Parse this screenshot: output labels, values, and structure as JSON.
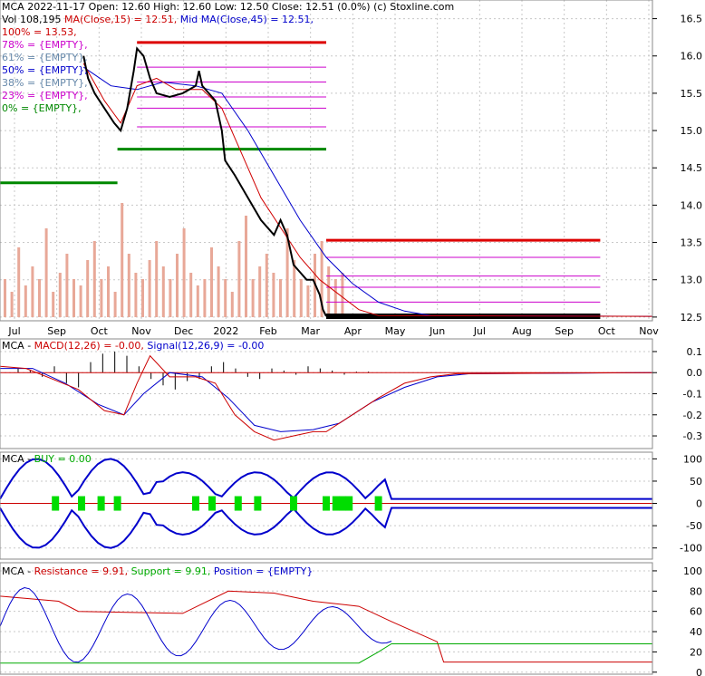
{
  "colors": {
    "price": "#000000",
    "ma_fast": "#d00000",
    "ma_slow": "#0000cc",
    "volume": "#e8a898",
    "support": "#008800",
    "resistance": "#dd0000",
    "fib": "#cc00cc",
    "buy": "#00dd00",
    "position": "#0000cc",
    "grid": "#c8c8c8"
  },
  "header": {
    "title_line": "MCA  2022-11-17 Open: 12.60  High: 12.60  Low: 12.50  Close: 12.51 (0.0%)  (c) Stoxline.com",
    "vol_prefix": "Vol 108,195 ",
    "ma15_label": "MA(Close,15) = 12.51,",
    "ma45_label": " Mid MA(Close,45) = 12.51,",
    "fib_levels": [
      {
        "label": "100% = 13.53,",
        "color": "#cc0000"
      },
      {
        "label": "78% = {EMPTY},",
        "color": "#cc00cc"
      },
      {
        "label": "61% = {EMPTY},",
        "color": "#6688aa"
      },
      {
        "label": "50% = {EMPTY},",
        "color": "#0000cc"
      },
      {
        "label": "38% = {EMPTY},",
        "color": "#6688aa"
      },
      {
        "label": "23% = {EMPTY},",
        "color": "#cc00cc"
      },
      {
        "label": "0% = {EMPTY},",
        "color": "#008800"
      }
    ]
  },
  "chart_data": [
    {
      "type": "line",
      "panel": "price",
      "title": "MCA  2022-11-17 Open: 12.60  High: 12.60  Low: 12.50  Close: 12.51 (0.0%)  (c) Stoxline.com",
      "x_labels": [
        "Jul",
        "Sep",
        "Oct",
        "Nov",
        "Dec",
        "2022",
        "Feb",
        "Mar",
        "Apr",
        "May",
        "Jun",
        "Jul",
        "Aug",
        "Sep",
        "Oct",
        "Nov"
      ],
      "y_ticks": [
        12.5,
        13.0,
        13.5,
        14.0,
        14.5,
        15.0,
        15.5,
        16.0,
        16.5
      ],
      "ylim": [
        12.45,
        16.75
      ],
      "price_points": [
        [
          0.128,
          16.0
        ],
        [
          0.135,
          15.7
        ],
        [
          0.145,
          15.5
        ],
        [
          0.16,
          15.3
        ],
        [
          0.175,
          15.1
        ],
        [
          0.185,
          15.0
        ],
        [
          0.195,
          15.3
        ],
        [
          0.205,
          15.8
        ],
        [
          0.21,
          16.1
        ],
        [
          0.22,
          16.0
        ],
        [
          0.23,
          15.7
        ],
        [
          0.24,
          15.5
        ],
        [
          0.26,
          15.45
        ],
        [
          0.28,
          15.5
        ],
        [
          0.3,
          15.6
        ],
        [
          0.305,
          15.8
        ],
        [
          0.31,
          15.6
        ],
        [
          0.32,
          15.5
        ],
        [
          0.33,
          15.4
        ],
        [
          0.34,
          15.0
        ],
        [
          0.345,
          14.6
        ],
        [
          0.36,
          14.4
        ],
        [
          0.38,
          14.1
        ],
        [
          0.4,
          13.8
        ],
        [
          0.42,
          13.6
        ],
        [
          0.43,
          13.8
        ],
        [
          0.44,
          13.6
        ],
        [
          0.45,
          13.2
        ],
        [
          0.46,
          13.1
        ],
        [
          0.47,
          13.0
        ],
        [
          0.48,
          13.0
        ],
        [
          0.49,
          12.8
        ],
        [
          0.495,
          12.6
        ],
        [
          0.5,
          12.51
        ]
      ],
      "ma15_points": [
        [
          0.128,
          15.9
        ],
        [
          0.16,
          15.4
        ],
        [
          0.185,
          15.1
        ],
        [
          0.21,
          15.6
        ],
        [
          0.24,
          15.7
        ],
        [
          0.27,
          15.55
        ],
        [
          0.31,
          15.55
        ],
        [
          0.34,
          15.3
        ],
        [
          0.37,
          14.7
        ],
        [
          0.4,
          14.1
        ],
        [
          0.43,
          13.7
        ],
        [
          0.46,
          13.3
        ],
        [
          0.49,
          13.0
        ],
        [
          0.52,
          12.8
        ],
        [
          0.55,
          12.6
        ],
        [
          0.58,
          12.52
        ],
        [
          1.0,
          12.51
        ]
      ],
      "ma45_points": [
        [
          0.128,
          15.85
        ],
        [
          0.17,
          15.6
        ],
        [
          0.21,
          15.55
        ],
        [
          0.25,
          15.65
        ],
        [
          0.3,
          15.6
        ],
        [
          0.34,
          15.5
        ],
        [
          0.38,
          15.0
        ],
        [
          0.42,
          14.4
        ],
        [
          0.46,
          13.8
        ],
        [
          0.5,
          13.3
        ],
        [
          0.54,
          12.95
        ],
        [
          0.58,
          12.7
        ],
        [
          0.62,
          12.58
        ],
        [
          0.66,
          12.52
        ],
        [
          1.0,
          12.51
        ]
      ],
      "volume_heights": [
        0.3,
        0.2,
        0.55,
        0.25,
        0.4,
        0.3,
        0.7,
        0.2,
        0.35,
        0.5,
        0.3,
        0.25,
        0.45,
        0.6,
        0.3,
        0.4,
        0.2,
        0.9,
        0.5,
        0.35,
        0.3,
        0.45,
        0.6,
        0.4,
        0.3,
        0.5,
        0.7,
        0.35,
        0.25,
        0.3,
        0.55,
        0.4,
        0.3,
        0.2,
        0.6,
        0.8,
        0.3,
        0.4,
        0.5,
        0.35,
        0.3,
        0.7,
        0.45,
        0.3,
        0.25,
        0.5,
        0.6,
        0.4,
        0.3,
        0.35
      ],
      "resistance_levels": [
        {
          "x0": 0.21,
          "x1": 0.5,
          "y": 16.18
        },
        {
          "x0": 0.5,
          "x1": 0.92,
          "y": 13.53
        }
      ],
      "support_levels": [
        {
          "x0": 0.0,
          "x1": 0.18,
          "y": 14.3
        },
        {
          "x0": 0.18,
          "x1": 0.5,
          "y": 14.75
        },
        {
          "x0": 0.5,
          "x1": 0.92,
          "y": 12.51
        }
      ],
      "fib_lines": [
        {
          "x0": 0.21,
          "x1": 0.5,
          "y": 15.85
        },
        {
          "x0": 0.21,
          "x1": 0.5,
          "y": 15.65
        },
        {
          "x0": 0.21,
          "x1": 0.5,
          "y": 15.45
        },
        {
          "x0": 0.21,
          "x1": 0.5,
          "y": 15.3
        },
        {
          "x0": 0.21,
          "x1": 0.5,
          "y": 15.05
        },
        {
          "x0": 0.5,
          "x1": 0.92,
          "y": 13.3
        },
        {
          "x0": 0.5,
          "x1": 0.92,
          "y": 13.05
        },
        {
          "x0": 0.5,
          "x1": 0.92,
          "y": 12.9
        },
        {
          "x0": 0.5,
          "x1": 0.92,
          "y": 12.7
        }
      ]
    },
    {
      "type": "line",
      "panel": "macd",
      "title": "MCA - MACD(12,26) = -0.00, Signal(12,26,9) = -0.00",
      "title_parts": {
        "prefix": "MCA - ",
        "macd": "MACD(12,26) = -0.00,",
        "signal": " Signal(12,26,9) = -0.00"
      },
      "y_ticks": [
        0.1,
        0.0,
        -0.1,
        -0.2,
        -0.3
      ],
      "ylim": [
        -0.36,
        0.16
      ],
      "macd_points": [
        [
          0.0,
          0.03
        ],
        [
          0.04,
          0.02
        ],
        [
          0.08,
          -0.03
        ],
        [
          0.12,
          -0.08
        ],
        [
          0.16,
          -0.18
        ],
        [
          0.19,
          -0.2
        ],
        [
          0.21,
          -0.05
        ],
        [
          0.23,
          0.08
        ],
        [
          0.26,
          -0.02
        ],
        [
          0.3,
          -0.02
        ],
        [
          0.33,
          -0.05
        ],
        [
          0.36,
          -0.2
        ],
        [
          0.39,
          -0.28
        ],
        [
          0.42,
          -0.32
        ],
        [
          0.45,
          -0.3
        ],
        [
          0.48,
          -0.28
        ],
        [
          0.5,
          -0.28
        ],
        [
          0.53,
          -0.22
        ],
        [
          0.58,
          -0.12
        ],
        [
          0.62,
          -0.05
        ],
        [
          0.66,
          -0.02
        ],
        [
          0.7,
          -0.005
        ],
        [
          1.0,
          0.0
        ]
      ],
      "signal_points": [
        [
          0.0,
          0.02
        ],
        [
          0.05,
          0.02
        ],
        [
          0.1,
          -0.05
        ],
        [
          0.15,
          -0.15
        ],
        [
          0.19,
          -0.2
        ],
        [
          0.22,
          -0.1
        ],
        [
          0.26,
          0.0
        ],
        [
          0.31,
          -0.02
        ],
        [
          0.35,
          -0.12
        ],
        [
          0.39,
          -0.25
        ],
        [
          0.43,
          -0.28
        ],
        [
          0.48,
          -0.27
        ],
        [
          0.52,
          -0.24
        ],
        [
          0.57,
          -0.14
        ],
        [
          0.62,
          -0.07
        ],
        [
          0.67,
          -0.02
        ],
        [
          0.72,
          -0.005
        ],
        [
          1.0,
          0.0
        ]
      ],
      "hist_values": [
        0.02,
        0.01,
        -0.02,
        0.03,
        -0.05,
        -0.07,
        0.05,
        0.09,
        0.1,
        0.08,
        0.03,
        -0.03,
        -0.06,
        -0.08,
        -0.04,
        -0.03,
        0.03,
        0.05,
        0.02,
        -0.02,
        -0.03,
        0.02,
        0.01,
        -0.01,
        0.03,
        0.02,
        0.01,
        -0.01,
        0.005,
        0.005
      ]
    },
    {
      "type": "line",
      "panel": "buy",
      "title": "MCA - BUY = 0.00",
      "title_parts": {
        "prefix": "MCA - ",
        "buy": "BUY = 0.00"
      },
      "y_ticks": [
        100,
        50,
        0,
        -50,
        -100
      ],
      "ylim": [
        -125,
        115
      ],
      "buy_markers": [
        0.085,
        0.125,
        0.155,
        0.18,
        0.3,
        0.325,
        0.365,
        0.395,
        0.45,
        0.5,
        0.515,
        0.525,
        0.535,
        0.58
      ]
    },
    {
      "type": "line",
      "panel": "resistance",
      "title": "MCA - Resistance = 9.91, Support = 9.91, Position = {EMPTY}",
      "title_parts": {
        "prefix": "MCA - ",
        "resistance": "Resistance = 9.91,",
        "support": " Support = 9.91,",
        "position": " Position = {EMPTY}"
      },
      "y_ticks": [
        100,
        80,
        60,
        40,
        20,
        0
      ],
      "ylim": [
        -2,
        108
      ]
    }
  ]
}
